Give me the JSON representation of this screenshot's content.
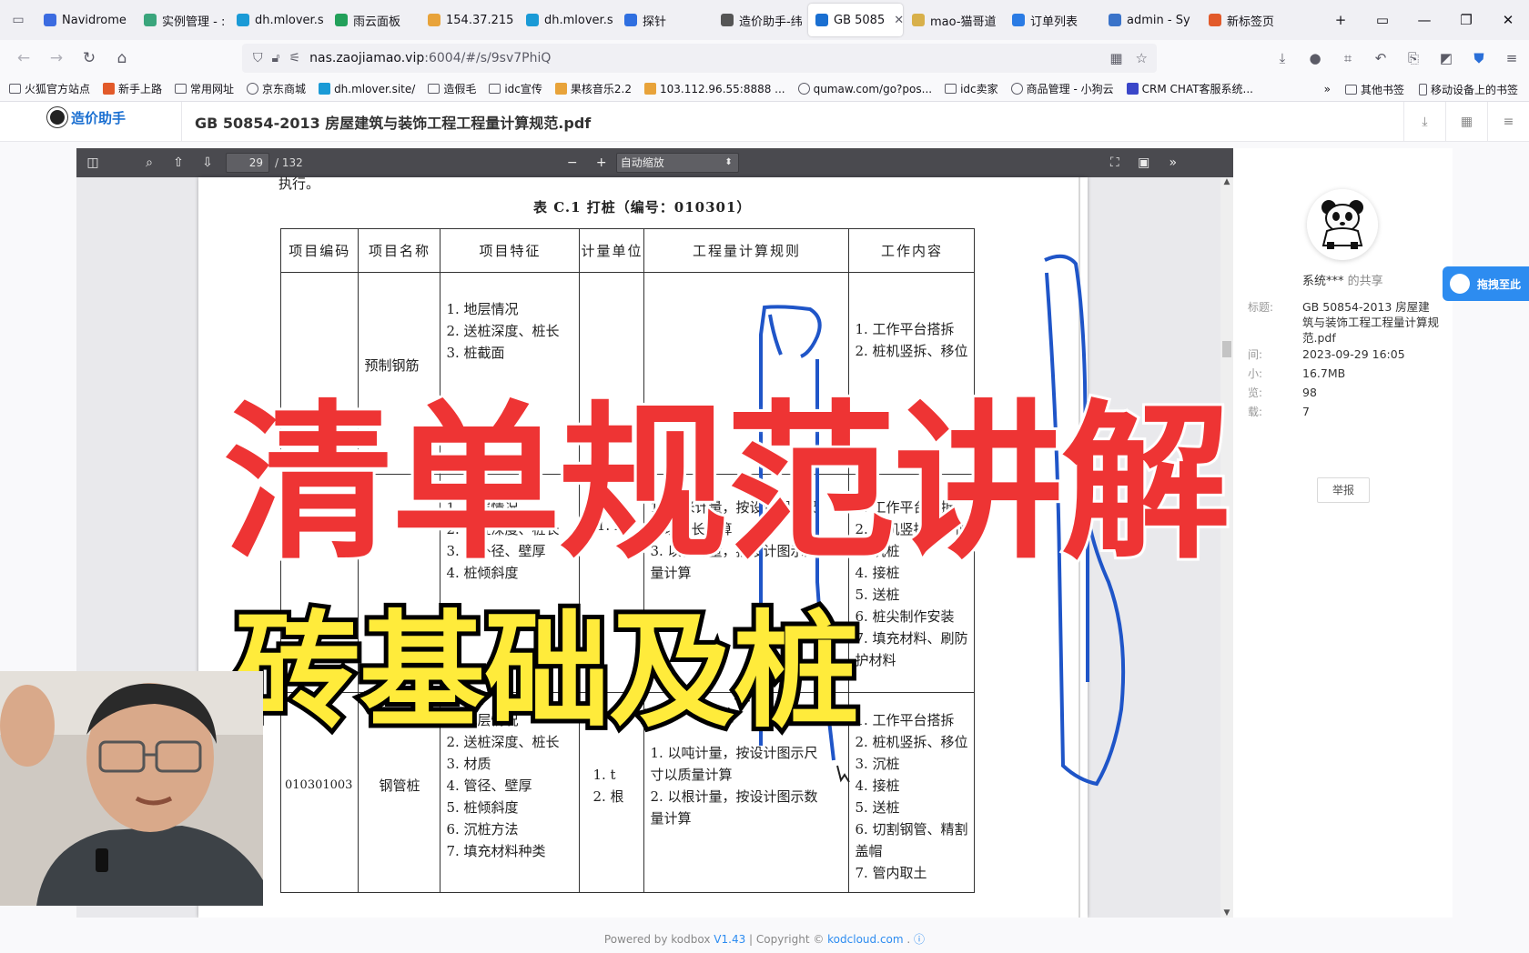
{
  "browser": {
    "tabs": [
      {
        "label": "Navidrome",
        "color": "#3b6be0"
      },
      {
        "label": "实例管理 - :",
        "color": "#3aa57c"
      },
      {
        "label": "dh.mlover.s",
        "color": "#1a9ad6"
      },
      {
        "label": "雨云面板",
        "color": "#22a05a"
      },
      {
        "label": "154.37.215",
        "color": "#e8a33a"
      },
      {
        "label": "dh.mlover.s",
        "color": "#1a9ad6"
      },
      {
        "label": "探针",
        "color": "#2f6fe0"
      },
      {
        "label": "造价助手-纬",
        "color": "#555555"
      },
      {
        "label": "GB 5085",
        "color": "#1a6fd1",
        "active": true
      },
      {
        "label": "mao-猫哥道",
        "color": "#d8b04a"
      },
      {
        "label": "订单列表",
        "color": "#2a7be4"
      },
      {
        "label": "admin - Sy",
        "color": "#3a73c9"
      },
      {
        "label": "新标签页",
        "color": "#e25a2a"
      }
    ],
    "url": {
      "host": "nas.zaojiamao.vip",
      "rest": ":6004/#/s/9sv7PhiQ"
    },
    "bookmarks": [
      {
        "label": "火狐官方站点",
        "type": "folder"
      },
      {
        "label": "新手上路",
        "type": "site",
        "color": "#e25a2a"
      },
      {
        "label": "常用网址",
        "type": "folder"
      },
      {
        "label": "京东商城",
        "type": "globe"
      },
      {
        "label": "dh.mlover.site/",
        "type": "site",
        "color": "#1a9ad6"
      },
      {
        "label": "造假毛",
        "type": "folder"
      },
      {
        "label": "idc宣传",
        "type": "folder"
      },
      {
        "label": "果核音乐2.2",
        "type": "site",
        "color": "#e8a33a"
      },
      {
        "label": "103.112.96.55:8888 ...",
        "type": "site",
        "color": "#e8a33a"
      },
      {
        "label": "qumaw.com/go?pos...",
        "type": "globe"
      },
      {
        "label": "idc卖家",
        "type": "folder"
      },
      {
        "label": "商品管理 - 小狗云",
        "type": "globe"
      },
      {
        "label": "CRM CHAT客服系统...",
        "type": "site",
        "color": "#3a46c9"
      }
    ],
    "bookmarks_right": [
      {
        "label": "其他书签"
      },
      {
        "label": "移动设备上的书签"
      }
    ]
  },
  "app": {
    "logo_text": "造价助手",
    "doc_title": "GB 50854-2013 房屋建筑与装饰工程工程量计算规范.pdf"
  },
  "pdf": {
    "page": "29",
    "total": "/ 132",
    "zoom": "自动缩放",
    "top_text": "执行。",
    "table_caption": "表 C.1    打桩（编号：010301）",
    "headers": [
      "项目编码",
      "项目名称",
      "项目特征",
      "计量单位",
      "工程量计算规则",
      "工作内容"
    ],
    "row1": {
      "name_partial": "预制钢筋",
      "features": [
        "1. 地层情况",
        "2. 送桩深度、桩长",
        "3. 桩截面"
      ],
      "work": [
        "1. 工作平台搭拆",
        "2. 桩机竖拆、移位"
      ]
    },
    "row2": {
      "features": [
        "1. 地层情况",
        "2. 送桩深度、桩长",
        "3. 桩外径、壁厚",
        "4. 桩倾斜度"
      ],
      "unit": "1. m",
      "rules": [
        "1. 以米计量，按设计图示尺",
        "寸以桩长计算",
        "3. 以根计量，按设计图示数",
        "量计算"
      ],
      "work": [
        "1. 工作平台搭拆",
        "2. 桩机竖拆、移位",
        "3. 沉桩",
        "4. 接桩",
        "5. 送桩",
        "6. 桩尖制作安装",
        "7. 填充材料、刷防",
        "护材料"
      ]
    },
    "row3": {
      "code": "010301003",
      "name": "钢管桩",
      "features": [
        "1. 地层情况",
        "2. 送桩深度、桩长",
        "3. 材质",
        "4. 管径、壁厚",
        "5. 桩倾斜度",
        "6. 沉桩方法",
        "7. 填充材料种类"
      ],
      "units": [
        "1. t",
        "2. 根"
      ],
      "rules": [
        "1. 以吨计量，按设计图示尺",
        "寸以质量计算",
        "2. 以根计量，按设计图示数",
        "量计算"
      ],
      "work": [
        "1. 工作平台搭拆",
        "2. 桩机竖拆、移位",
        "3. 沉桩",
        "4. 接桩",
        "5. 送桩",
        "6. 切割钢管、精割",
        "盖帽",
        "7. 管内取土"
      ]
    }
  },
  "info": {
    "share_user": "系统***",
    "share_suffix": " 的共享",
    "title_label": "标题:",
    "title_value": "GB 50854-2013 房屋建筑与装饰工程工程量计算规范.pdf",
    "date_label": "间:",
    "date_value": "2023-09-29 16:05",
    "size_label": "小:",
    "size_value": "16.7MB",
    "views_label": "览:",
    "views_value": "98",
    "dl_label": "载:",
    "dl_value": "7",
    "report": "举报",
    "float_btn": "拖拽至此"
  },
  "footer": {
    "powered": "Powered by kodbox ",
    "version": "V1.43",
    "sep": " | Copyright © ",
    "site": "kodcloud.com",
    "dot": " ."
  },
  "overlay": {
    "main_title": "清单规范讲解",
    "sub_title": "砖基础及桩",
    "main_color": "#ee3434",
    "sub_color": "#ffeb3b"
  }
}
